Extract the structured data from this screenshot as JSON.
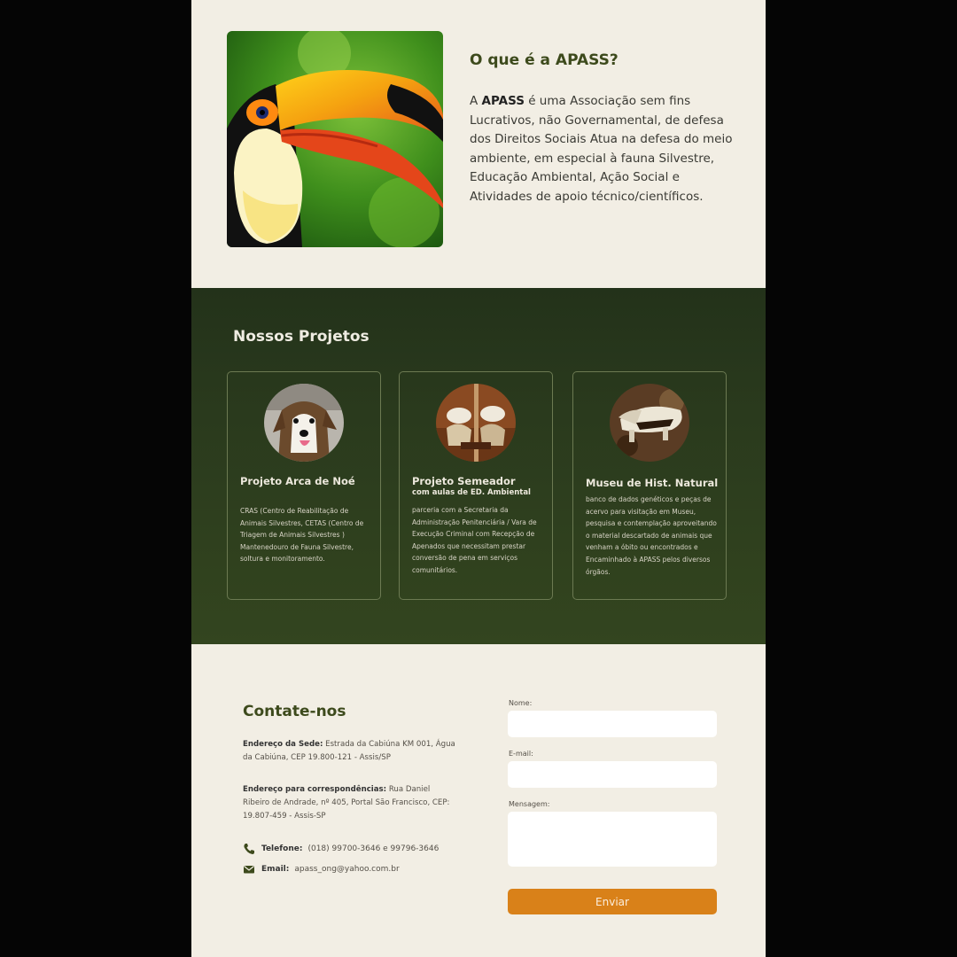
{
  "colors": {
    "page_bg": "#f2eee4",
    "projects_bg": "#2a3a1d",
    "title_green": "#3d4a1c",
    "button_orange": "#d98119"
  },
  "about": {
    "image_icon": "toucan-photo",
    "title": "O que é a APASS?",
    "text_bold": "APASS",
    "text_prefix": "A ",
    "text_rest": " é uma Associação sem fins Lucrativos, não Governamental, de defesa dos Direitos Sociais Atua na defesa do meio ambiente, em especial à fauna Silvestre, Educação Ambiental, Ação Social e Atividades de apoio técnico/científicos."
  },
  "projects": {
    "title": "Nossos Projetos",
    "cards": [
      {
        "image_icon": "dog-photo",
        "title": "Projeto Arca de Noé",
        "subtitle": "",
        "text": "CRAS (Centro de Reabilitação de Animais Silvestres, CETAS (Centro de Triagem de Animais Silvestres ) Mantenedouro de Fauna Silvestre, soltura e monitoramento."
      },
      {
        "image_icon": "planting-photo",
        "title": "Projeto Semeador",
        "subtitle": "com aulas de ED. Ambiental",
        "text": "parceria com a Secretaria da Administração Penitenciária / Vara de Execução Criminal com Recepção de Apenados que necessitam prestar conversão de pena em serviços comunitários."
      },
      {
        "image_icon": "anteater-photo",
        "title": "Museu de Hist. Natural",
        "subtitle": "",
        "text": "banco de dados genéticos e peças de acervo para visitação em Museu, pesquisa e contemplação aproveitando o material descartado de animais que venham a óbito ou encontrados e Encaminhado à APASS pelos diversos órgãos."
      }
    ]
  },
  "contact": {
    "title": "Contate-nos",
    "address1_label": "Endereço da Sede:",
    "address1_text": " Estrada da Cabiúna KM 001,  Água da Cabiúna, CEP 19.800-121 - Assis/SP",
    "address2_label": "Endereço para correspondências:",
    "address2_text": " Rua Daniel Ribeiro de Andrade, nº 405, Portal São Francisco, CEP: 19.807-459 - Assis-SP",
    "phone_icon": "phone-icon",
    "phone_label": "Telefone:",
    "phone_value": "(018) 99700-3646 e 99796-3646",
    "email_icon": "envelope-icon",
    "email_label": "Email:",
    "email_value": "apass_ong@yahoo.com.br"
  },
  "form": {
    "name_label": "Nome:",
    "name_value": "",
    "email_label": "E-mail:",
    "email_value": "",
    "message_label": "Mensagem:",
    "message_value": "",
    "submit_label": "Enviar"
  }
}
